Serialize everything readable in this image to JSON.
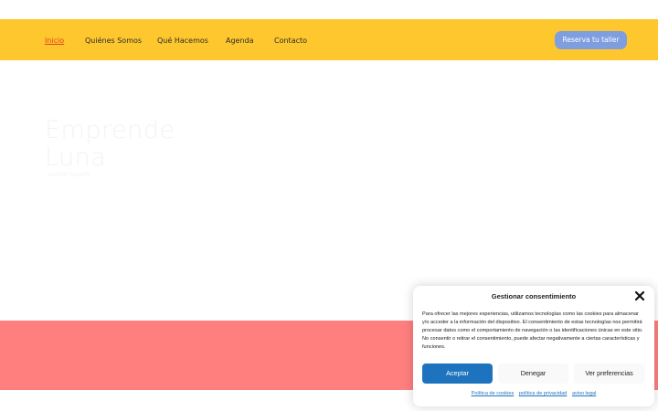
{
  "nav": {
    "items": [
      "Inicio",
      "Quiénes Somos",
      "Qué Hacemos",
      "Agenda",
      "Contacto"
    ],
    "active_index": 0,
    "cta_label": "Reserva tu taller"
  },
  "hero": {
    "title": "Emprende\nLuna",
    "subtitle": "Lorem ipsum"
  },
  "consent": {
    "title": "Gestionar consentimiento",
    "body": "Para ofrecer las mejores experiencias, utilizamos tecnologías como las cookies para almacenar y/o acceder a la información del dispositivo. El consentimiento de estas tecnologías nos permitirá procesar datos como el comportamiento de navegación o las identificaciones únicas en este sitio. No consentir o retirar el consentimiento, puede afectar negativamente a ciertas características y funciones.",
    "accept_label": "Aceptar",
    "deny_label": "Denegar",
    "prefs_label": "Ver preferencias",
    "links": [
      "Política de cookies",
      "política de privacidad",
      "aviso legal"
    ]
  },
  "colors": {
    "nav_bg": "#fec72e",
    "cta_bg": "#7f9ee0",
    "band_bg": "#ff7f7f",
    "accept_bg": "#1e73be",
    "active_link": "#e2401c"
  }
}
